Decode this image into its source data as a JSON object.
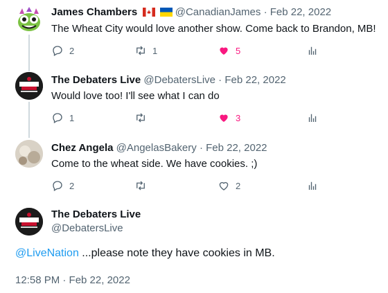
{
  "tweets": [
    {
      "name": "James Chambers",
      "handle": "@CanadianJames",
      "sep": "·",
      "date": "Feb 22, 2022",
      "text": "The Wheat City would love another show. Come back to Brandon, MB!",
      "replies": "2",
      "retweets": "1",
      "likes": "5"
    },
    {
      "name": "The Debaters Live",
      "handle": "@DebatersLive",
      "sep": "·",
      "date": "Feb 22, 2022",
      "text": "Would love too! I'll see what I can do",
      "replies": "1",
      "retweets": "",
      "likes": "3"
    },
    {
      "name": "Chez Angela",
      "handle": "@AngelasBakery",
      "sep": "·",
      "date": "Feb 22, 2022",
      "text": "Come to the wheat side. We have cookies. ;)",
      "replies": "2",
      "retweets": "",
      "likes": "2"
    }
  ],
  "main": {
    "name": "The Debaters Live",
    "handle": "@DebatersLive",
    "mention": "@LiveNation",
    "text": " ...please note they have cookies in MB.",
    "timestamp": "12:58 PM · Feb 22, 2022"
  },
  "colors": {
    "like_active": "#f91880",
    "mention": "#1d9bf0",
    "meta": "#536471"
  }
}
